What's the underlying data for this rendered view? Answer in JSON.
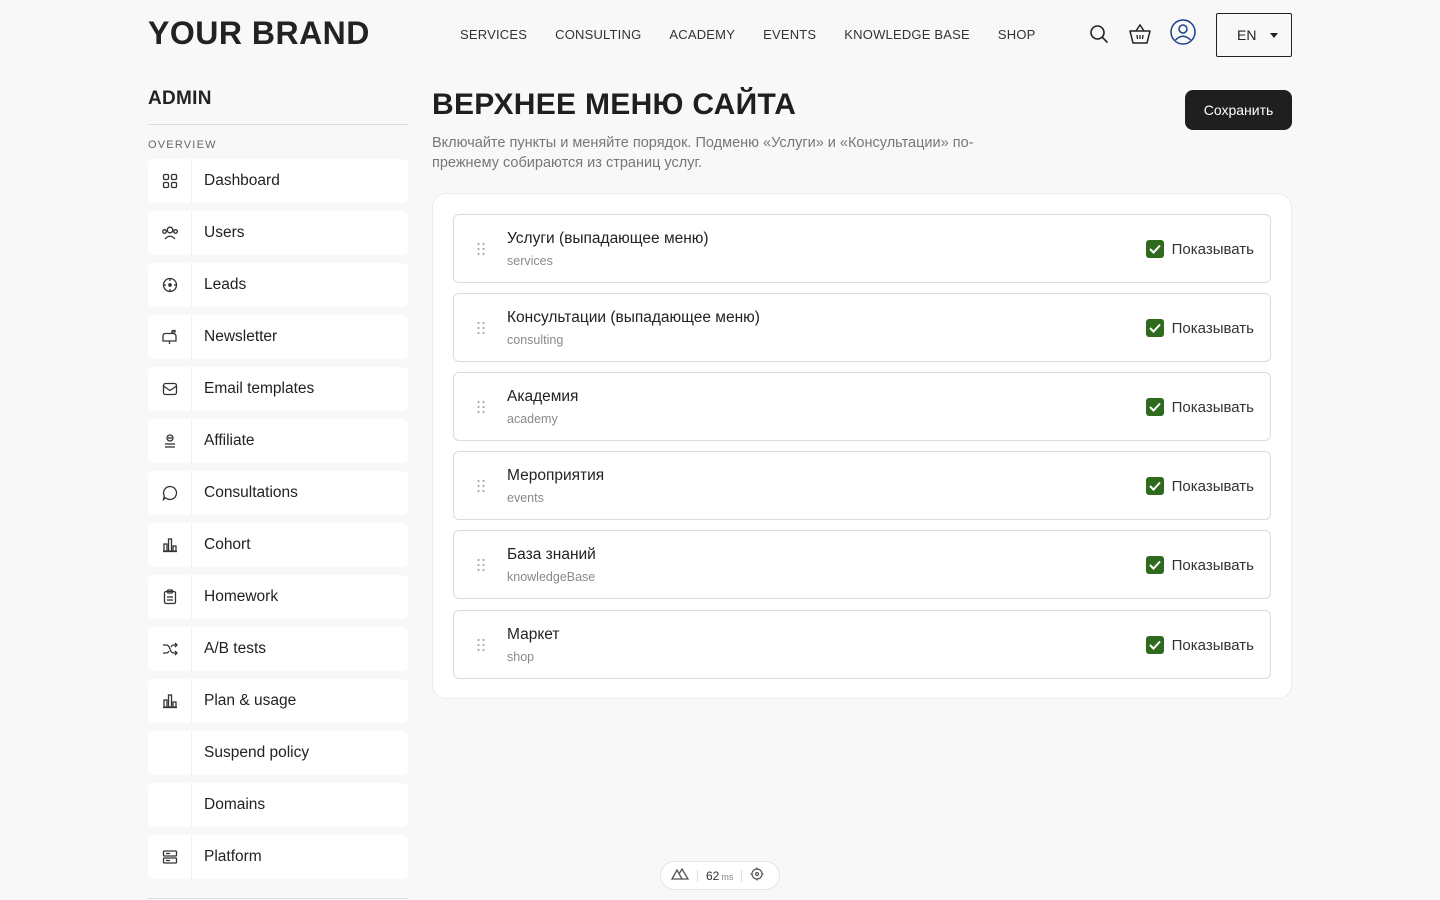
{
  "header": {
    "brand": "YOUR BRAND",
    "nav": [
      "SERVICES",
      "CONSULTING",
      "ACADEMY",
      "EVENTS",
      "KNOWLEDGE BASE",
      "SHOP"
    ],
    "language": "EN",
    "icons": [
      "search-icon",
      "cart-icon",
      "user-icon"
    ]
  },
  "sidebar": {
    "title": "ADMIN",
    "section": "OVERVIEW",
    "items": [
      {
        "label": "Dashboard",
        "icon": "grid-icon"
      },
      {
        "label": "Users",
        "icon": "users-icon"
      },
      {
        "label": "Leads",
        "icon": "target-icon"
      },
      {
        "label": "Newsletter",
        "icon": "mailbox-icon"
      },
      {
        "label": "Email templates",
        "icon": "envelope-icon"
      },
      {
        "label": "Affiliate",
        "icon": "affiliate-icon"
      },
      {
        "label": "Consultations",
        "icon": "chat-icon"
      },
      {
        "label": "Cohort",
        "icon": "bar-chart-icon"
      },
      {
        "label": "Homework",
        "icon": "clipboard-icon"
      },
      {
        "label": "A/B tests",
        "icon": "shuffle-icon"
      },
      {
        "label": "Plan & usage",
        "icon": "bar-chart-icon"
      },
      {
        "label": "Suspend policy",
        "icon": ""
      },
      {
        "label": "Domains",
        "icon": ""
      },
      {
        "label": "Platform",
        "icon": "server-icon"
      }
    ]
  },
  "main": {
    "title": "ВЕРХНЕЕ МЕНЮ САЙТА",
    "description": "Включайте пункты и меняйте порядок. Подменю «Услуги» и «Консультации» по-прежнему собираются из страниц услуг.",
    "save_label": "Сохранить",
    "show_label": "Показывать",
    "items": [
      {
        "title": "Услуги (выпадающее меню)",
        "key": "services",
        "visible": true
      },
      {
        "title": "Консультации (выпадающее меню)",
        "key": "consulting",
        "visible": true
      },
      {
        "title": "Академия",
        "key": "academy",
        "visible": true
      },
      {
        "title": "Мероприятия",
        "key": "events",
        "visible": true
      },
      {
        "title": "База знаний",
        "key": "knowledgeBase",
        "visible": true
      },
      {
        "title": "Маркет",
        "key": "shop",
        "visible": true
      }
    ]
  },
  "perf": {
    "value": "62",
    "unit": "ms"
  },
  "colors": {
    "accent": "#1f1f1f",
    "checkbox": "#2e6b1f",
    "background": "#f8f8f8"
  }
}
